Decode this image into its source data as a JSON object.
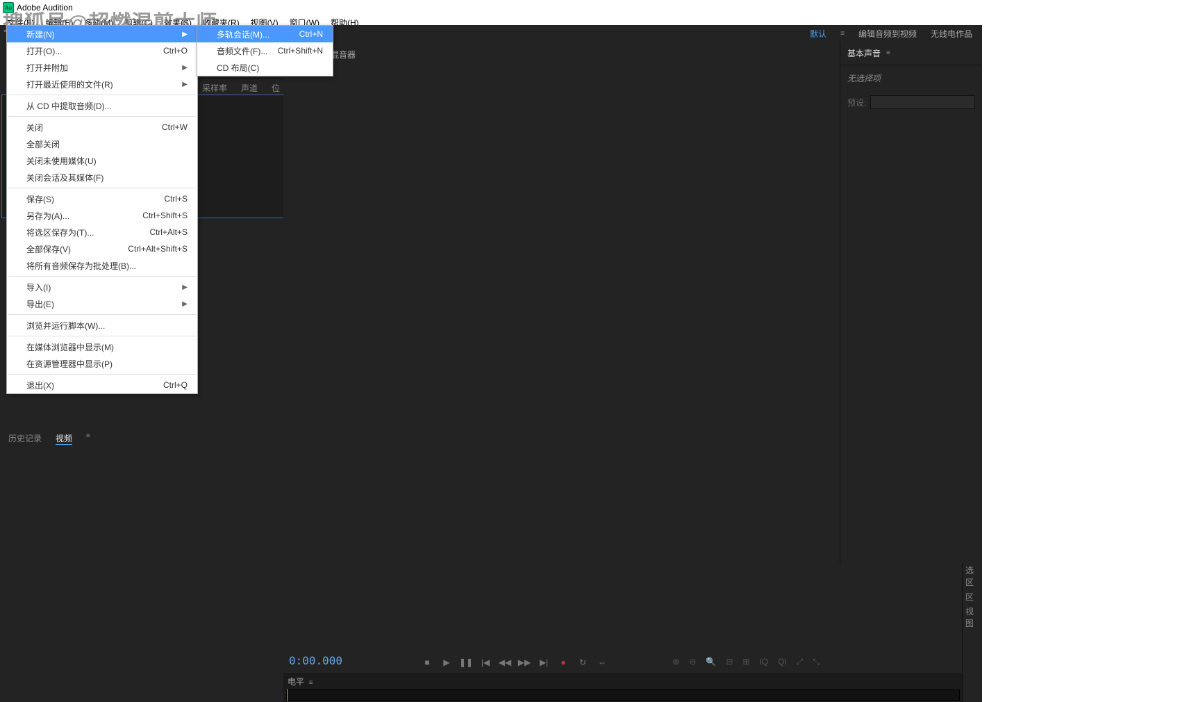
{
  "title": "Adobe Audition",
  "watermark": "搜狐号@超燃混剪大师",
  "menubar": [
    "文件(F)",
    "编辑(E)",
    "多轨(M)",
    "剪辑(C)",
    "效果(S)",
    "收藏夹(R)",
    "视图(V)",
    "窗口(W)",
    "帮助(H)"
  ],
  "workspaces": {
    "items": [
      "默认",
      "编辑音频到视频",
      "无线电作品"
    ],
    "active": 0,
    "burger": "≡"
  },
  "file_menu": [
    {
      "label": "新建(N)",
      "shortcut": "",
      "arrow": true,
      "hl": true
    },
    {
      "label": "打开(O)...",
      "shortcut": "Ctrl+O"
    },
    {
      "label": "打开并附加",
      "shortcut": "",
      "arrow": true
    },
    {
      "label": "打开最近使用的文件(R)",
      "shortcut": "",
      "arrow": true
    },
    {
      "sep": true
    },
    {
      "label": "从 CD 中提取音频(D)...",
      "shortcut": ""
    },
    {
      "sep": true
    },
    {
      "label": "关闭",
      "shortcut": "Ctrl+W"
    },
    {
      "label": "全部关闭",
      "shortcut": ""
    },
    {
      "label": "关闭未使用媒体(U)",
      "shortcut": ""
    },
    {
      "label": "关闭会话及其媒体(F)",
      "shortcut": ""
    },
    {
      "sep": true
    },
    {
      "label": "保存(S)",
      "shortcut": "Ctrl+S"
    },
    {
      "label": "另存为(A)...",
      "shortcut": "Ctrl+Shift+S"
    },
    {
      "label": "将选区保存为(T)...",
      "shortcut": "Ctrl+Alt+S"
    },
    {
      "label": "全部保存(V)",
      "shortcut": "Ctrl+Alt+Shift+S"
    },
    {
      "label": "将所有音频保存为批处理(B)...",
      "shortcut": ""
    },
    {
      "sep": true
    },
    {
      "label": "导入(I)",
      "shortcut": "",
      "arrow": true
    },
    {
      "label": "导出(E)",
      "shortcut": "",
      "arrow": true
    },
    {
      "sep": true
    },
    {
      "label": "浏览并运行脚本(W)...",
      "shortcut": ""
    },
    {
      "sep": true
    },
    {
      "label": "在媒体浏览器中显示(M)",
      "shortcut": ""
    },
    {
      "label": "在资源管理器中显示(P)",
      "shortcut": ""
    },
    {
      "sep": true
    },
    {
      "label": "退出(X)",
      "shortcut": "Ctrl+Q"
    }
  ],
  "sub_menu": [
    {
      "label": "多轨会话(M)...",
      "shortcut": "Ctrl+N",
      "hl": true
    },
    {
      "label": "音频文件(F)...",
      "shortcut": "Ctrl+Shift+N"
    },
    {
      "label": "CD 布局(C)",
      "shortcut": ""
    }
  ],
  "files_headers": [
    "采样率",
    "声道",
    "位"
  ],
  "editor_tab": "混音器",
  "bottom_tabs": {
    "items": [
      "历史记录",
      "视频"
    ],
    "active": 1,
    "burger": "≡"
  },
  "right_panel": {
    "title": "基本声音",
    "burger": "≡",
    "none_selected": "无选择项",
    "preset": "预设:"
  },
  "timecode": "0:00.000",
  "transport_icons": [
    "■",
    "▶",
    "❚❚",
    "|◀",
    "◀◀",
    "▶▶",
    "▶|",
    "●",
    "↻",
    "⇔"
  ],
  "zoom_icons": [
    "⊕",
    "⊖",
    "🔍",
    "⊟",
    "⊞",
    "IQ",
    "QI",
    "⤢",
    "⤡"
  ],
  "level_label": "电平",
  "level_burger": "≡",
  "sel_labels": [
    "选区",
    "区",
    "视图"
  ],
  "logo_text": "Au"
}
